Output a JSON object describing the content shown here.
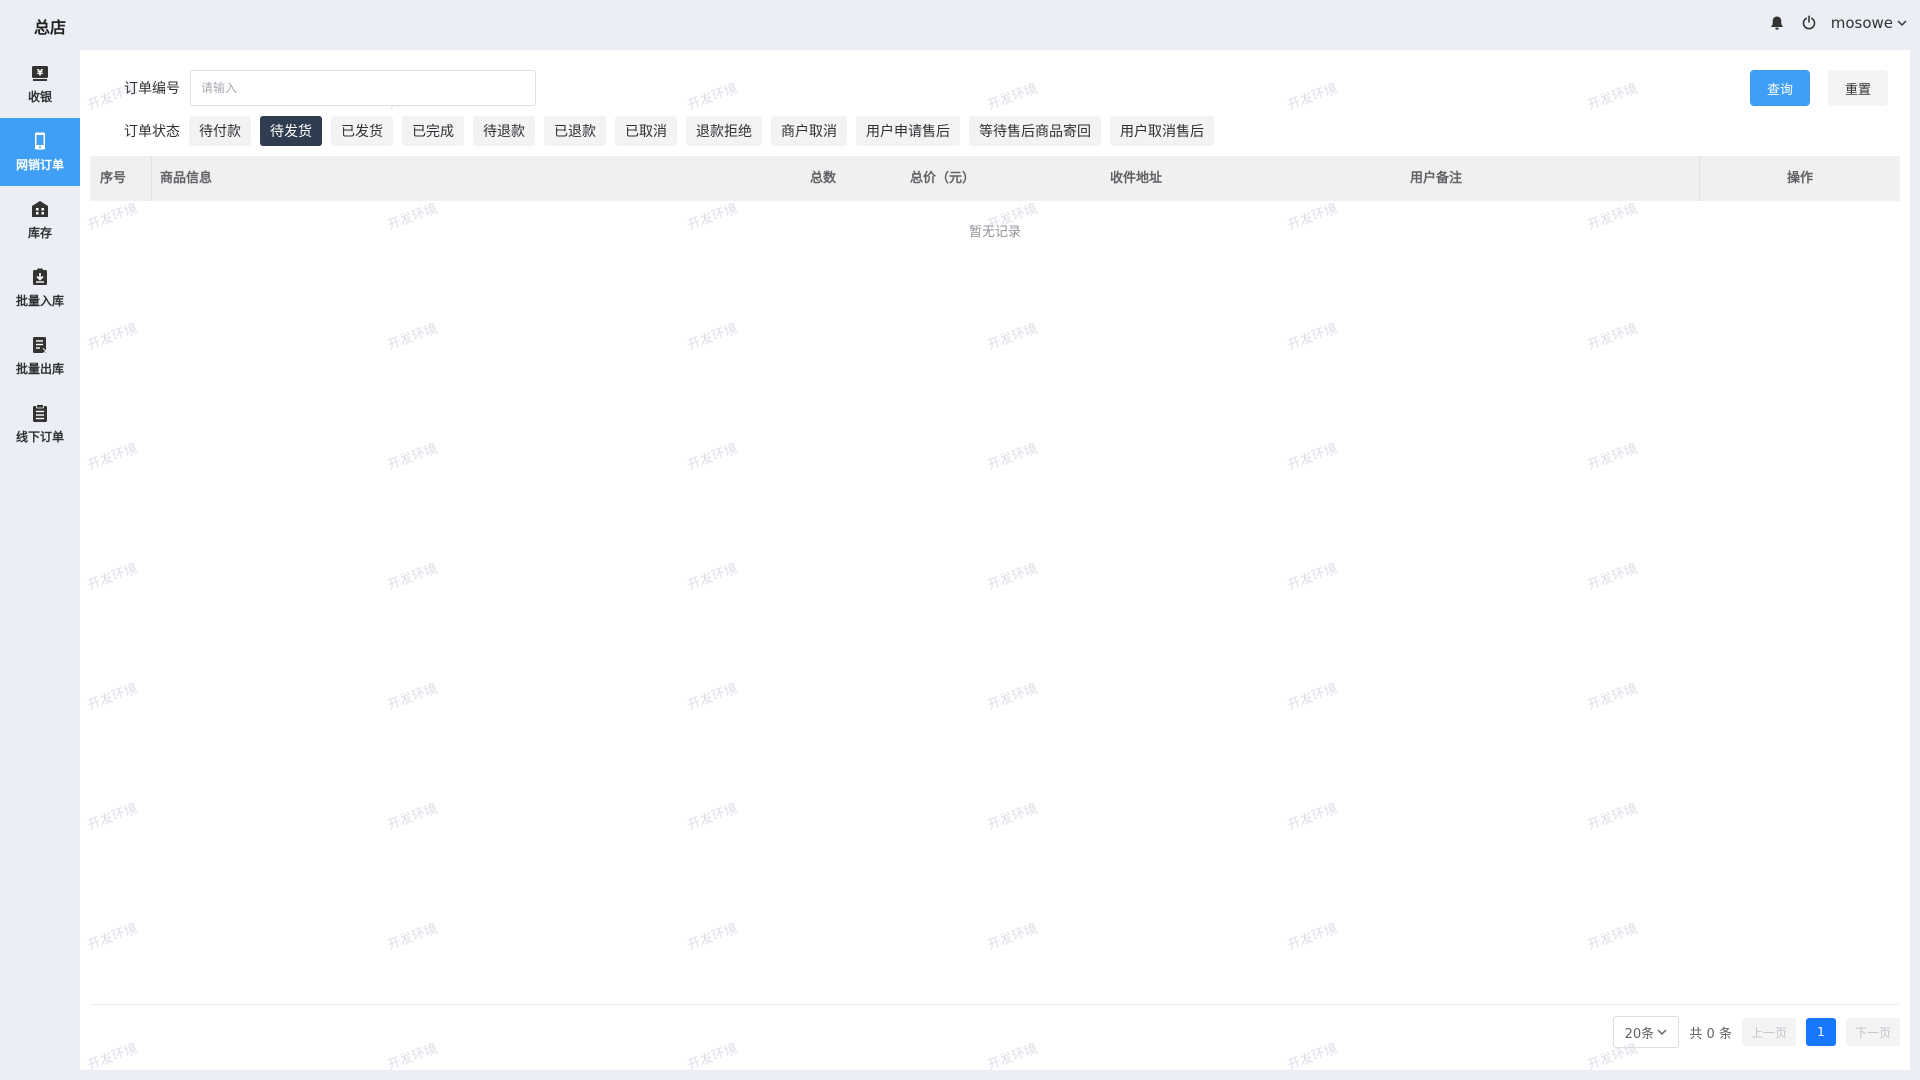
{
  "header": {
    "store_name": "总店",
    "username": "mosowe"
  },
  "sidebar": {
    "items": [
      {
        "label": "收银",
        "icon": "cashier-icon"
      },
      {
        "label": "网销订单",
        "icon": "phone-icon"
      },
      {
        "label": "库存",
        "icon": "warehouse-icon"
      },
      {
        "label": "批量入库",
        "icon": "inbound-icon"
      },
      {
        "label": "批量出库",
        "icon": "outbound-icon"
      },
      {
        "label": "线下订单",
        "icon": "clipboard-icon"
      }
    ],
    "active_index": 1
  },
  "filters": {
    "order_no_label": "订单编号",
    "order_no_placeholder": "请输入",
    "order_no_value": "",
    "status_label": "订单状态",
    "statuses": [
      "待付款",
      "待发货",
      "已发货",
      "已完成",
      "待退款",
      "已退款",
      "已取消",
      "退款拒绝",
      "商户取消",
      "用户申请售后",
      "等待售后商品寄回",
      "用户取消售后"
    ],
    "active_status_index": 1,
    "query_label": "查询",
    "reset_label": "重置"
  },
  "table": {
    "columns": [
      "序号",
      "商品信息",
      "总数",
      "总价（元）",
      "收件地址",
      "用户备注",
      "操作"
    ],
    "empty_text": "暂无记录"
  },
  "pagination": {
    "page_size": "20条",
    "total_text": "共 0 条",
    "prev_label": "上一页",
    "current_page": "1",
    "next_label": "下一页"
  },
  "watermark": "开发环境"
}
